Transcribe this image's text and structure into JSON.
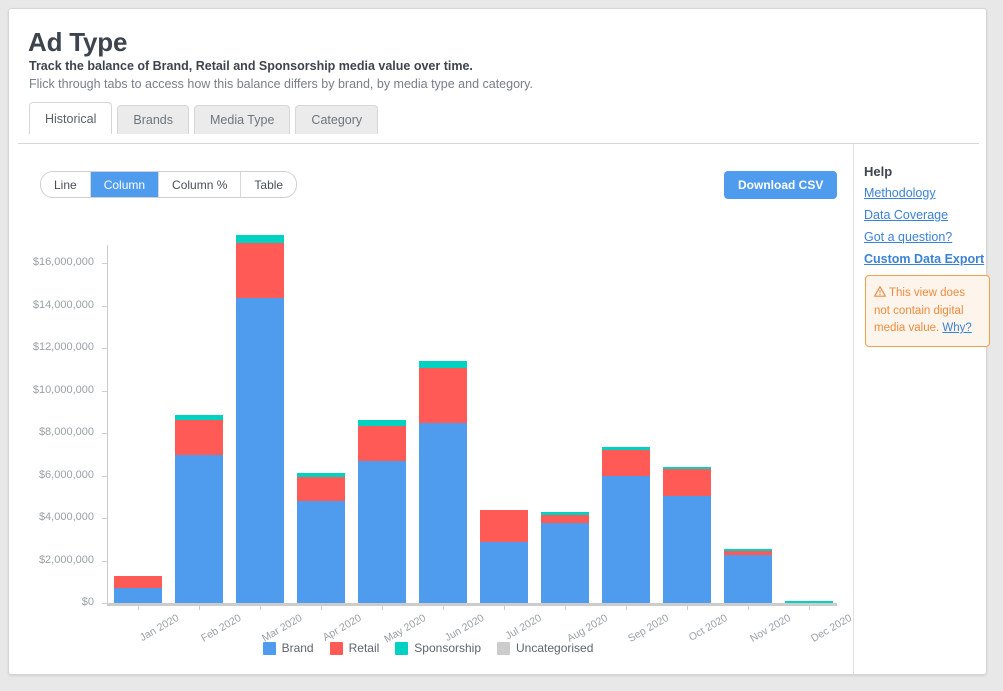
{
  "header": {
    "title": "Ad Type",
    "subtitle_bold": "Track the balance of Brand, Retail and Sponsorship media value over time.",
    "subtitle_light": "Flick through tabs to access how this balance differs by brand, by media type and category."
  },
  "tabs": [
    {
      "label": "Historical",
      "active": true
    },
    {
      "label": "Brands",
      "active": false
    },
    {
      "label": "Media Type",
      "active": false
    },
    {
      "label": "Category",
      "active": false
    }
  ],
  "toolbar": {
    "view_modes": [
      {
        "label": "Line",
        "active": false
      },
      {
        "label": "Column",
        "active": true
      },
      {
        "label": "Column %",
        "active": false
      },
      {
        "label": "Table",
        "active": false
      }
    ],
    "download_label": "Download CSV"
  },
  "help": {
    "title": "Help",
    "links": [
      {
        "label": "Methodology",
        "bold": false
      },
      {
        "label": "Data Coverage",
        "bold": false
      },
      {
        "label": "Got a question?",
        "bold": false
      },
      {
        "label": "Custom Data Export",
        "bold": true
      }
    ],
    "warning": {
      "icon": "warning-triangle-icon",
      "text": "This view does not contain digital media value.",
      "link_label": "Why?"
    }
  },
  "colors": {
    "brand": "#4f9bee",
    "retail": "#ff5a55",
    "sponsorship": "#00d1c1",
    "uncategorised": "#cccccc",
    "accent": "#4f9bee",
    "warning_border": "#f0a24a",
    "warning_text": "#ef8b3c",
    "link": "#3b82d6"
  },
  "chart_data": {
    "type": "bar",
    "stacked": true,
    "title": "",
    "xlabel": "",
    "ylabel": "",
    "ylim": [
      0,
      17200000
    ],
    "grid": false,
    "legend_position": "bottom",
    "ytick_labels": [
      "$0",
      "$2,000,000",
      "$4,000,000",
      "$6,000,000",
      "$8,000,000",
      "$10,000,000",
      "$12,000,000",
      "$14,000,000",
      "$16,000,000"
    ],
    "ytick_values": [
      0,
      2000000,
      4000000,
      6000000,
      8000000,
      10000000,
      12000000,
      14000000,
      16000000
    ],
    "categories": [
      "Jan 2020",
      "Feb 2020",
      "Mar 2020",
      "Apr 2020",
      "May 2020",
      "Jun 2020",
      "Jul 2020",
      "Aug 2020",
      "Sep 2020",
      "Oct 2020",
      "Nov 2020",
      "Dec 2020"
    ],
    "series": [
      {
        "name": "Brand",
        "color": "#4f9bee",
        "values": [
          700000,
          6950000,
          14350000,
          4800000,
          6700000,
          8450000,
          2850000,
          3750000,
          6000000,
          5050000,
          2250000,
          0
        ]
      },
      {
        "name": "Retail",
        "color": "#ff5a55",
        "values": [
          550000,
          1650000,
          2600000,
          1150000,
          1650000,
          2600000,
          1550000,
          400000,
          1200000,
          1250000,
          200000,
          0
        ]
      },
      {
        "name": "Sponsorship",
        "color": "#00d1c1",
        "values": [
          0,
          250000,
          350000,
          150000,
          250000,
          350000,
          0,
          150000,
          150000,
          100000,
          100000,
          80000
        ]
      },
      {
        "name": "Uncategorised",
        "color": "#cccccc",
        "values": [
          0,
          0,
          0,
          0,
          0,
          0,
          0,
          0,
          0,
          0,
          0,
          0
        ]
      }
    ],
    "legend": [
      {
        "label": "Brand",
        "color": "#4f9bee"
      },
      {
        "label": "Retail",
        "color": "#ff5a55"
      },
      {
        "label": "Sponsorship",
        "color": "#00d1c1"
      },
      {
        "label": "Uncategorised",
        "color": "#cccccc"
      }
    ]
  }
}
